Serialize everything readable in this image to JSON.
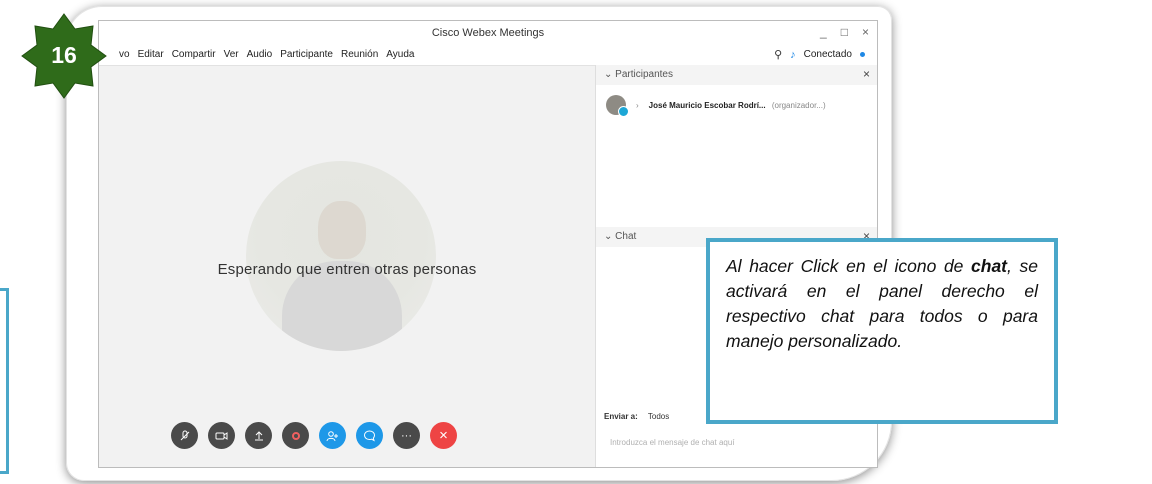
{
  "window": {
    "title": "Cisco Webex Meetings",
    "controls": [
      "_",
      "□",
      "×"
    ]
  },
  "menu": {
    "items": [
      "vo",
      "Editar",
      "Compartir",
      "Ver",
      "Audio",
      "Participante",
      "Reunión",
      "Ayuda"
    ],
    "status_label": "Conectado",
    "status_color": "#1e88e5"
  },
  "stage": {
    "waiting_text": "Esperando que entren otras personas"
  },
  "controls": [
    {
      "name": "mute-button",
      "icon": "mic-off-icon"
    },
    {
      "name": "video-button",
      "icon": "video-icon"
    },
    {
      "name": "share-button",
      "icon": "upload-icon"
    },
    {
      "name": "record-button",
      "icon": "record-icon"
    },
    {
      "name": "participants-button",
      "icon": "participants-icon"
    },
    {
      "name": "chat-button",
      "icon": "chat-icon"
    },
    {
      "name": "more-button",
      "icon": "more-icon",
      "label": "···"
    },
    {
      "name": "end-call-button",
      "icon": "close-icon",
      "label": "×"
    }
  ],
  "participants_panel": {
    "title": "Participantes",
    "participant": {
      "name": "José Mauricio Escobar Rodrí...",
      "role": "(organizador...)"
    }
  },
  "chat_panel": {
    "title": "Chat",
    "send_to_label": "Enviar a:",
    "send_to_value": "Todos",
    "input_placeholder": "Introduzca el mensaje de chat aquí"
  },
  "step_badge": {
    "number": "16",
    "color": "#2f6b1a"
  },
  "callout": {
    "text_before": "Al hacer Click en el icono de ",
    "bold_word": "chat",
    "text_after": ", se activará en el panel derecho el respectivo chat para todos o para manejo personalizado.",
    "border_color": "#4aa7c9"
  }
}
